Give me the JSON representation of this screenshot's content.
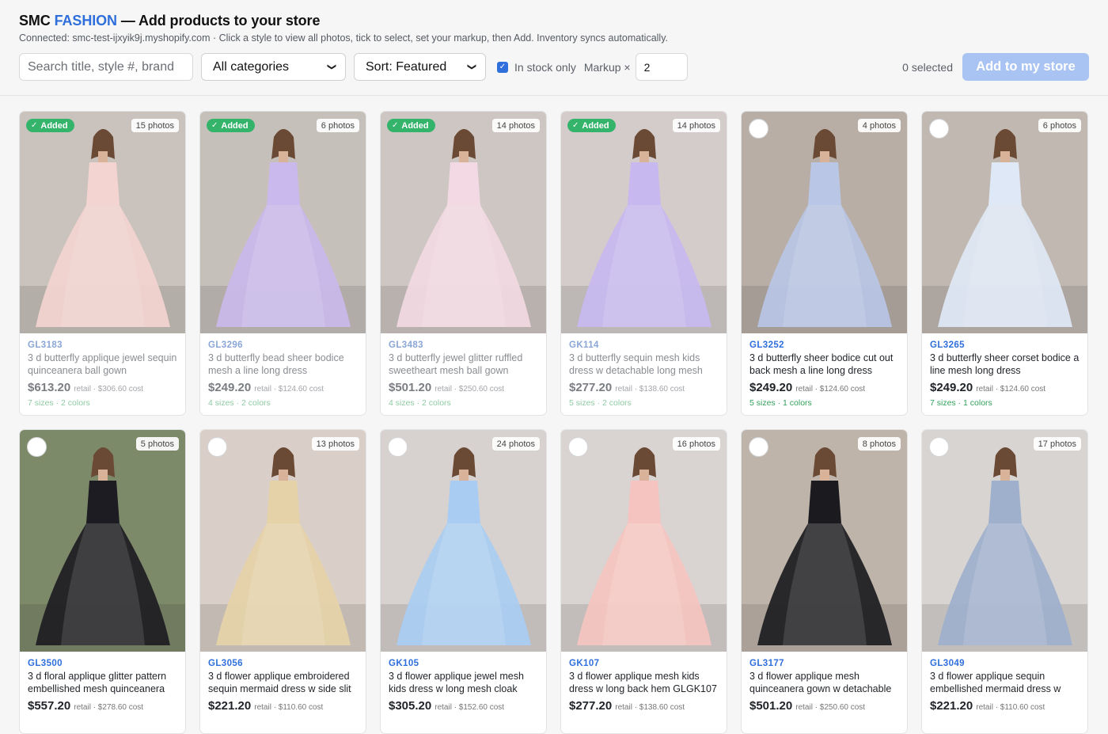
{
  "header": {
    "brand_smc": "SMC",
    "brand_fashion": "FASHION",
    "title_rest": "— Add products to your store",
    "subtitle": "Connected: smc-test-ijxyik9j.myshopify.com · Click a style to view all photos, tick to select, set your markup, then Add. Inventory syncs automatically."
  },
  "controls": {
    "search_placeholder": "Search title, style #, brand",
    "category_value": "All categories",
    "sort_value": "Sort: Featured",
    "in_stock_label": "In stock only",
    "in_stock_checked": true,
    "markup_label": "Markup ×",
    "markup_value": "2",
    "selected_count": "0 selected",
    "add_button_label": "Add to my store"
  },
  "colors": {
    "accent": "#2f6fdb",
    "added_green": "#34b36b",
    "meta_green": "#34a15b",
    "add_button_disabled": "#a9c4f2"
  },
  "added_badge_label": "Added",
  "products": [
    {
      "style": "GL3183",
      "name": "3 d butterfly applique jewel sequin quinceanera ball gown",
      "price": "$613.20",
      "retail_note": "retail · $306.60 cost",
      "meta": "7 sizes · 2 colors",
      "photos": "15 photos",
      "added": true,
      "dress_color": "#f3d4d0",
      "bg": "#c9c2bd"
    },
    {
      "style": "GL3296",
      "name": "3 d butterfly bead sheer bodice mesh a line long dress",
      "price": "$249.20",
      "retail_note": "retail · $124.60 cost",
      "meta": "4 sizes · 2 colors",
      "photos": "6 photos",
      "added": true,
      "dress_color": "#c9b9ec",
      "bg": "#c6c0bb"
    },
    {
      "style": "GL3483",
      "name": "3 d butterfly jewel glitter ruffled sweetheart mesh ball gown",
      "price": "$501.20",
      "retail_note": "retail · $250.60 cost",
      "meta": "4 sizes · 2 colors",
      "photos": "14 photos",
      "added": true,
      "dress_color": "#f2d9e3",
      "bg": "#cdc6c2"
    },
    {
      "style": "GK114",
      "name": "3 d butterfly sequin mesh kids dress w detachable long mesh",
      "price": "$277.20",
      "retail_note": "retail · $138.60 cost",
      "meta": "5 sizes · 2 colors",
      "photos": "14 photos",
      "added": true,
      "dress_color": "#c7b8f0",
      "bg": "#d3cccb"
    },
    {
      "style": "GL3252",
      "name": "3 d butterfly sheer bodice cut out back mesh a line long dress",
      "price": "$249.20",
      "retail_note": "retail · $124.60 cost",
      "meta": "5 sizes · 1 colors",
      "photos": "4 photos",
      "added": false,
      "dress_color": "#b9c6e6",
      "bg": "#b8aea6"
    },
    {
      "style": "GL3265",
      "name": "3 d butterfly sheer corset bodice a line mesh long dress",
      "price": "$249.20",
      "retail_note": "retail · $124.60 cost",
      "meta": "7 sizes · 1 colors",
      "photos": "6 photos",
      "added": false,
      "dress_color": "#dfe8f6",
      "bg": "#c1b8b1"
    },
    {
      "style": "GL3500",
      "name": "3 d floral applique glitter pattern embellished mesh quinceanera",
      "price": "$557.20",
      "retail_note": "retail · $278.60 cost",
      "meta": "",
      "photos": "5 photos",
      "added": false,
      "dress_color": "#1d1c22",
      "bg": "#7d8a6a"
    },
    {
      "style": "GL3056",
      "name": "3 d flower applique embroidered sequin mermaid dress w side slit",
      "price": "$221.20",
      "retail_note": "retail · $110.60 cost",
      "meta": "",
      "photos": "13 photos",
      "added": false,
      "dress_color": "#e6d2a8",
      "bg": "#d9cfc8"
    },
    {
      "style": "GK105",
      "name": "3 d flower applique jewel mesh kids dress w long mesh cloak",
      "price": "$305.20",
      "retail_note": "retail · $152.60 cost",
      "meta": "",
      "photos": "24 photos",
      "added": false,
      "dress_color": "#a9cdf2",
      "bg": "#d7d1cf"
    },
    {
      "style": "GK107",
      "name": "3 d flower applique mesh kids dress w long back hem GLGK107",
      "price": "$277.20",
      "retail_note": "retail · $138.60 cost",
      "meta": "",
      "photos": "16 photos",
      "added": false,
      "dress_color": "#f6c4c0",
      "bg": "#d9d3d1"
    },
    {
      "style": "GL3177",
      "name": "3 d flower applique mesh quinceanera gown w detachable",
      "price": "$501.20",
      "retail_note": "retail · $250.60 cost",
      "meta": "",
      "photos": "8 photos",
      "added": false,
      "dress_color": "#1b1b1f",
      "bg": "#bfb4aa"
    },
    {
      "style": "GL3049",
      "name": "3 d flower applique sequin embellished mermaid dress w",
      "price": "$221.20",
      "retail_note": "retail · $110.60 cost",
      "meta": "",
      "photos": "17 photos",
      "added": false,
      "dress_color": "#9fb0cc",
      "bg": "#d8d4d1"
    }
  ]
}
